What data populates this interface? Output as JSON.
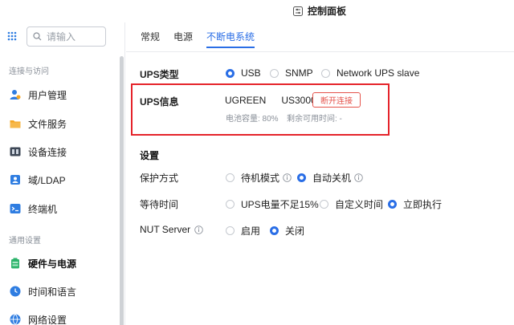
{
  "titlebar": {
    "title": "控制面板",
    "icon": "control-panel-icon"
  },
  "sidebar": {
    "search_placeholder": "请输入",
    "groups": [
      {
        "label": "连接与访问"
      },
      {
        "label": "通用设置"
      }
    ],
    "items": [
      {
        "label": "用户管理",
        "icon": "user-icon",
        "color": "#2f7de1"
      },
      {
        "label": "文件服务",
        "icon": "folder-icon",
        "color": "#f5a623"
      },
      {
        "label": "设备连接",
        "icon": "device-icon",
        "color": "#3d4756"
      },
      {
        "label": "域/LDAP",
        "icon": "domain-icon",
        "color": "#2f7de1"
      },
      {
        "label": "终端机",
        "icon": "terminal-icon",
        "color": "#2f7de1"
      },
      {
        "label": "硬件与电源",
        "icon": "battery-icon",
        "color": "#2db36b",
        "active": true
      },
      {
        "label": "时间和语言",
        "icon": "clock-icon",
        "color": "#2f7de1"
      },
      {
        "label": "网络设置",
        "icon": "globe-icon",
        "color": "#2f7de1"
      }
    ]
  },
  "tabs": [
    {
      "label": "常规"
    },
    {
      "label": "电源"
    },
    {
      "label": "不断电系统",
      "active": true
    }
  ],
  "ups_type": {
    "label": "UPS类型",
    "options": [
      "USB",
      "SNMP",
      "Network UPS slave"
    ],
    "selected": "USB"
  },
  "ups_info": {
    "label": "UPS信息",
    "model": "UGREEN   US3000",
    "disconnect_label": "断开连接",
    "battery": "电池容量: 80%",
    "remaining": "剩余可用时间: -"
  },
  "settings": {
    "title": "设置",
    "protect_mode": {
      "label": "保护方式",
      "options": [
        "待机模式",
        "自动关机"
      ],
      "selected": "自动关机"
    },
    "wait_time": {
      "label": "等待时间",
      "options": [
        "UPS电量不足15%",
        "自定义时间",
        "立即执行"
      ],
      "selected": "立即执行"
    },
    "nut_server": {
      "label": "NUT Server",
      "options": [
        "启用",
        "关闭"
      ],
      "selected": "关闭"
    }
  },
  "colors": {
    "accent": "#2a6ee6",
    "danger": "#e5232a"
  }
}
